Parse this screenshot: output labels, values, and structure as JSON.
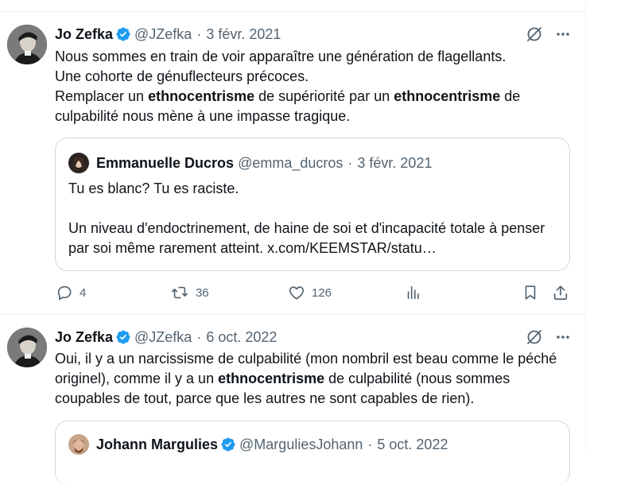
{
  "tweets": [
    {
      "author_name": "Jo Zefka",
      "handle": "@JZefka",
      "separator": "·",
      "date": "3 févr. 2021",
      "line1": "Nous sommes en train de voir apparaître une génération de flagellants.",
      "line2": "Une cohorte de génuflecteurs précoces.",
      "line3_pre": "Remplacer un ",
      "keyword": "ethnocentrisme",
      "line3_mid": " de supériorité par un ",
      "line3_post": " de culpabilité nous mène à une impasse tragique.",
      "quote": {
        "author_name": "Emmanuelle Ducros",
        "handle": "@emma_ducros",
        "separator": "·",
        "date": "3 févr. 2021",
        "line1": "Tu es blanc? Tu es raciste.",
        "line2": "Un niveau d'endoctrinement, de haine de soi et d'incapacité totale à penser par soi même rarement atteint. x.com/KEEMSTAR/statu…"
      },
      "actions": {
        "replies": "4",
        "retweets": "36",
        "likes": "126"
      }
    },
    {
      "author_name": "Jo Zefka",
      "handle": "@JZefka",
      "separator": "·",
      "date": "6 oct. 2022",
      "text_pre": "Oui, il y a un narcissisme de culpabilité (mon nombril est beau comme le péché originel), comme il y a un ",
      "keyword": "ethnocentrisme",
      "text_post": " de culpabilité (nous sommes coupables de tout, parce que les autres ne sont capables de rien).",
      "quote": {
        "author_name": "Johann Margulies",
        "handle": "@MarguliesJohann",
        "separator": "·",
        "date": "5 oct. 2022"
      }
    }
  ],
  "colors": {
    "verified": "#1d9bf0",
    "muted": "#536471",
    "border": "#cfd9de",
    "divider": "#eff3f4"
  },
  "icons": [
    "verified-badge-icon",
    "grok-icon",
    "more-icon",
    "reply-icon",
    "retweet-icon",
    "like-icon",
    "views-icon",
    "bookmark-icon",
    "share-icon"
  ]
}
